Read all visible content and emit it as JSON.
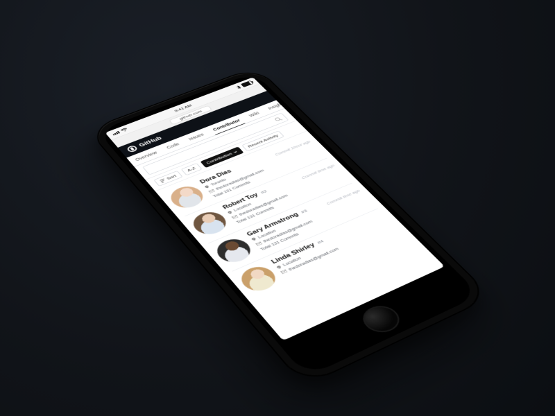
{
  "status": {
    "time": "9:41 AM",
    "carrier": "•••",
    "bt": "Bluetooth",
    "batt_pct": 100
  },
  "browser": {
    "url": "github.com"
  },
  "gh": {
    "brand": "GitHub"
  },
  "tabs": {
    "items": [
      {
        "label": "Overview"
      },
      {
        "label": "Code"
      },
      {
        "label": "Issues"
      },
      {
        "label": "Contributor"
      },
      {
        "label": "Wiki"
      },
      {
        "label": "Insights"
      }
    ],
    "active_index": 3
  },
  "search": {
    "placeholder": ""
  },
  "filters": {
    "sort_label": "Sort",
    "az_label": "A-Z",
    "contribution_label": "Contribution",
    "recent_label": "Recent Activity"
  },
  "contributors": [
    {
      "name": "Dora Dias",
      "rank": "",
      "location": "Toronto",
      "email": "thedoradias@gmail.com",
      "commits": "Total 131 Commits",
      "commit_time": "Commit 1hour ago"
    },
    {
      "name": "Robert Toy",
      "rank": "#2",
      "location": "Location",
      "email": "thedoradias@gmail.com",
      "commits": "Total 131 Commits",
      "commit_time": "Commit time ago"
    },
    {
      "name": "Gary Armstrong",
      "rank": "#3",
      "location": "Location",
      "email": "thedoradias@gmail.com",
      "commits": "Total 131 Commits",
      "commit_time": "Commit time ago"
    },
    {
      "name": "Linda Shirley",
      "rank": "#4",
      "location": "Location",
      "email": "thedoradias@gmail.com",
      "commits": "",
      "commit_time": ""
    }
  ]
}
